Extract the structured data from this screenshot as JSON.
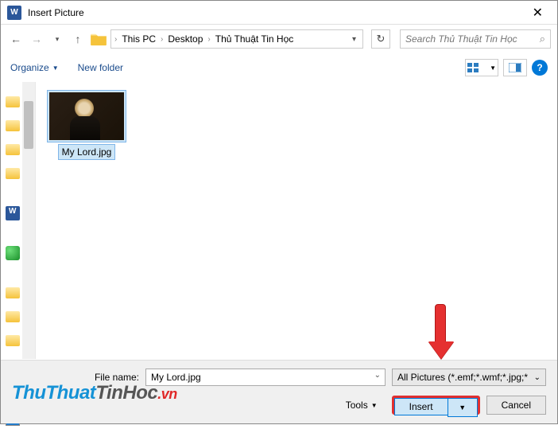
{
  "window": {
    "title": "Insert Picture"
  },
  "breadcrumb": {
    "items": [
      "This PC",
      "Desktop",
      "Thủ Thuật Tin Học"
    ]
  },
  "search": {
    "placeholder": "Search Thủ Thuật Tin Học"
  },
  "toolbar": {
    "organize": "Organize",
    "new_folder": "New folder"
  },
  "files": {
    "selected": {
      "name": "My Lord.jpg"
    }
  },
  "bottom": {
    "filename_label": "File name:",
    "filename_value": "My Lord.jpg",
    "filter": "All Pictures (*.emf;*.wmf;*.jpg;*",
    "tools": "Tools",
    "insert": "Insert",
    "cancel": "Cancel"
  },
  "watermark": {
    "p1": "ThuThuat",
    "p2": "TinHoc",
    "p3": ".vn"
  }
}
